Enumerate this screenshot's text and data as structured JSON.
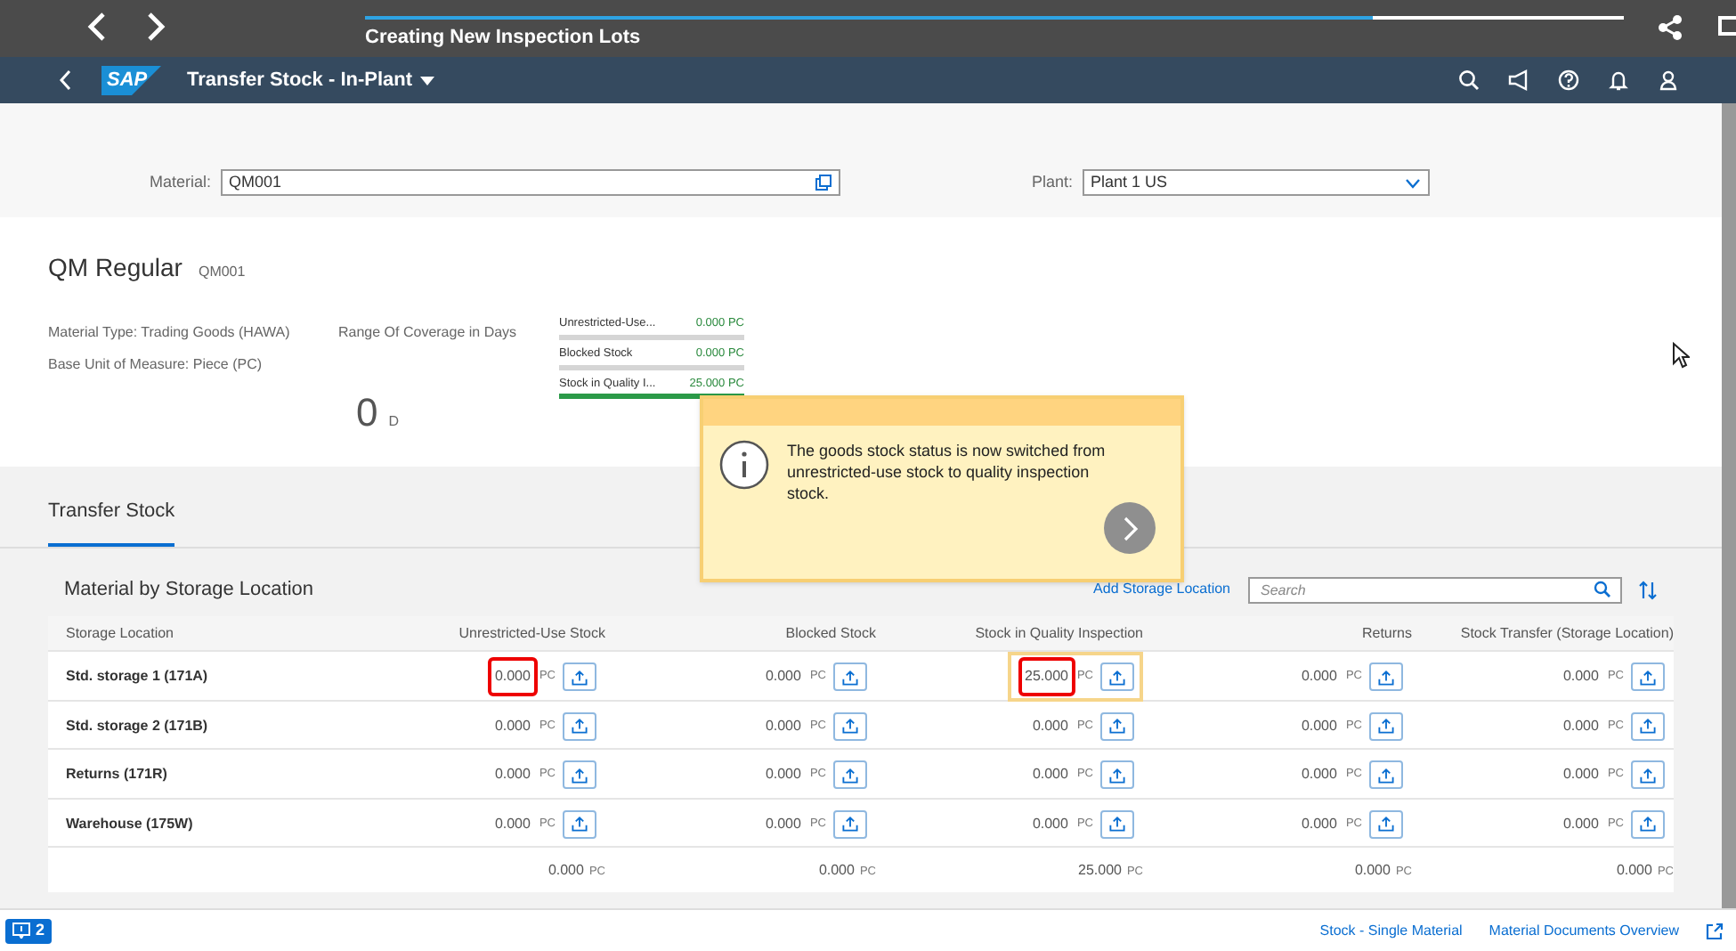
{
  "tour_bar": {
    "title": "Creating New Inspection Lots",
    "level": 0.8
  },
  "shell": {
    "logo": "SAP",
    "title": "Transfer Stock - In-Plant"
  },
  "filters": [
    {
      "label": "Material:",
      "value": "QM001",
      "kind": "valuehelp"
    },
    {
      "label": "Plant:",
      "value": "Plant 1 US",
      "kind": "select"
    }
  ],
  "object_header": {
    "title": "QM Regular",
    "subtitle": "QM001",
    "attributes": [
      "Material Type: Trading Goods (HAWA)",
      "Base Unit of Measure: Piece (PC)"
    ],
    "coverage": {
      "label": "Range Of Coverage in Days",
      "value": "0",
      "unit": "D"
    },
    "stock_bars": [
      {
        "label": "Unrestricted-Use...",
        "value": "0.000 PC",
        "level": 0
      },
      {
        "label": "Blocked Stock",
        "value": "0.000 PC",
        "level": 0
      },
      {
        "label": "Stock in Quality I...",
        "value": "25.000 PC",
        "level": 1
      }
    ]
  },
  "callout": {
    "text": "The goods stock status is now switched from unrestricted-use stock to quality inspection stock."
  },
  "tabs": [
    {
      "label": "Transfer Stock",
      "selected": true
    }
  ],
  "table": {
    "title": "Material by Storage Location",
    "add_link": "Add Storage Location",
    "search": {
      "placeholder": "Search"
    },
    "location_column": "Storage Location",
    "columns": [
      "Unrestricted-Use Stock",
      "Blocked Stock",
      "Stock in Quality Inspection",
      "Returns",
      "Stock Transfer (Storage Location)"
    ],
    "rows": [
      {
        "location": "Std. storage 1 (171A)",
        "cells": [
          {
            "value": "0.000",
            "unit": "PC",
            "highlighted": true,
            "framed": false
          },
          {
            "value": "0.000",
            "unit": "PC",
            "highlighted": false,
            "framed": false
          },
          {
            "value": "25.000",
            "unit": "PC",
            "highlighted": true,
            "framed": true
          },
          {
            "value": "0.000",
            "unit": "PC",
            "highlighted": false,
            "framed": false
          },
          {
            "value": "0.000",
            "unit": "PC",
            "highlighted": false,
            "framed": false
          }
        ]
      },
      {
        "location": "Std. storage 2 (171B)",
        "cells": [
          {
            "value": "0.000",
            "unit": "PC",
            "highlighted": false,
            "framed": false
          },
          {
            "value": "0.000",
            "unit": "PC",
            "highlighted": false,
            "framed": false
          },
          {
            "value": "0.000",
            "unit": "PC",
            "highlighted": false,
            "framed": false
          },
          {
            "value": "0.000",
            "unit": "PC",
            "highlighted": false,
            "framed": false
          },
          {
            "value": "0.000",
            "unit": "PC",
            "highlighted": false,
            "framed": false
          }
        ]
      },
      {
        "location": "Returns (171R)",
        "cells": [
          {
            "value": "0.000",
            "unit": "PC",
            "highlighted": false,
            "framed": false
          },
          {
            "value": "0.000",
            "unit": "PC",
            "highlighted": false,
            "framed": false
          },
          {
            "value": "0.000",
            "unit": "PC",
            "highlighted": false,
            "framed": false
          },
          {
            "value": "0.000",
            "unit": "PC",
            "highlighted": false,
            "framed": false
          },
          {
            "value": "0.000",
            "unit": "PC",
            "highlighted": false,
            "framed": false
          }
        ]
      },
      {
        "location": "Warehouse (175W)",
        "cells": [
          {
            "value": "0.000",
            "unit": "PC",
            "highlighted": false,
            "framed": false
          },
          {
            "value": "0.000",
            "unit": "PC",
            "highlighted": false,
            "framed": false
          },
          {
            "value": "0.000",
            "unit": "PC",
            "highlighted": false,
            "framed": false
          },
          {
            "value": "0.000",
            "unit": "PC",
            "highlighted": false,
            "framed": false
          },
          {
            "value": "0.000",
            "unit": "PC",
            "highlighted": false,
            "framed": false
          }
        ]
      }
    ],
    "totals": [
      {
        "value": "0.000",
        "unit": "PC"
      },
      {
        "value": "0.000",
        "unit": "PC"
      },
      {
        "value": "25.000",
        "unit": "PC"
      },
      {
        "value": "0.000",
        "unit": "PC"
      },
      {
        "value": "0.000",
        "unit": "PC"
      }
    ]
  },
  "footer": {
    "messages": "2",
    "links": [
      "Stock - Single Material",
      "Material Documents Overview"
    ]
  }
}
